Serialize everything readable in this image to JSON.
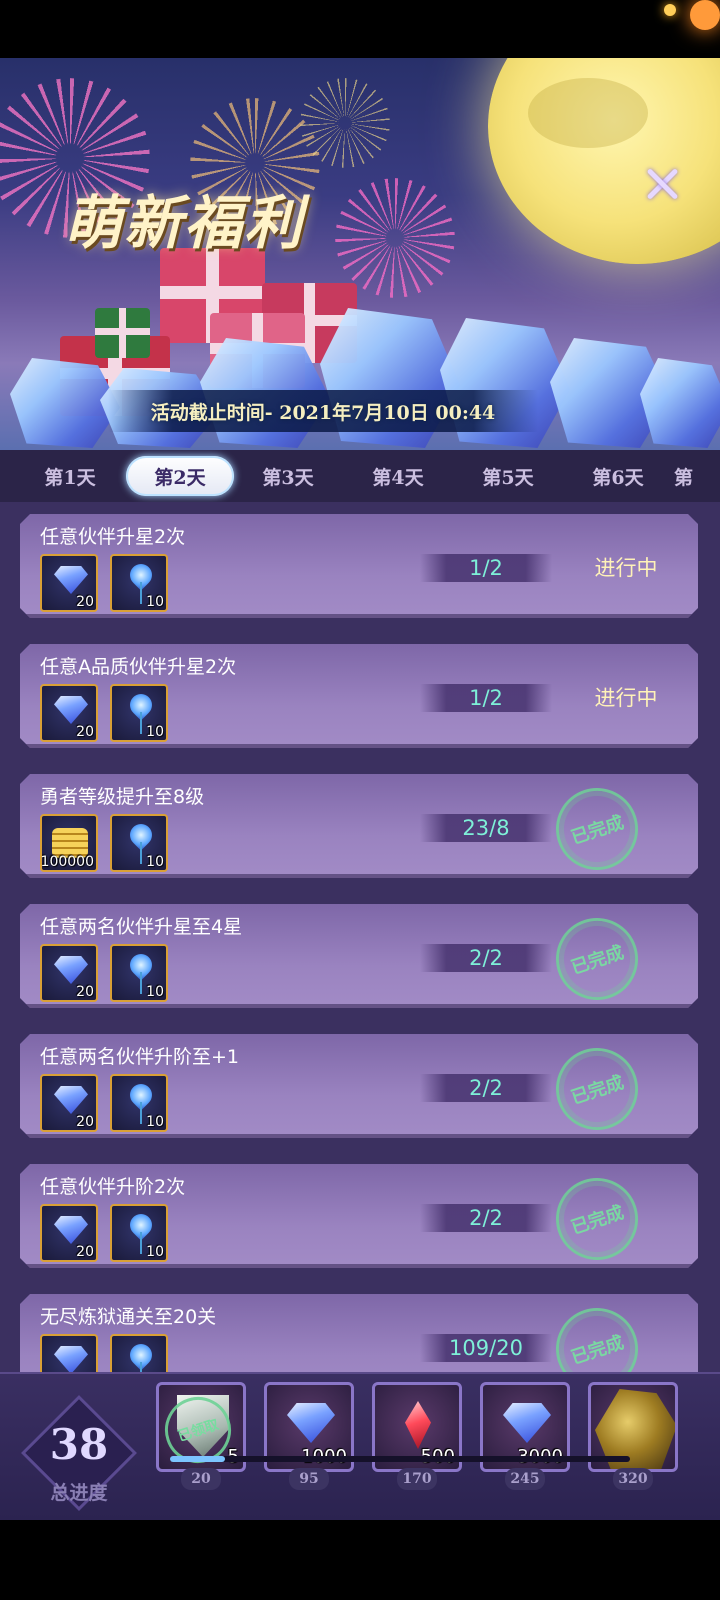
{
  "banner": {
    "title": "萌新福利",
    "deadline": "活动截止时间- 2021年7月10日 00:44"
  },
  "tabs": [
    {
      "label": "第1天",
      "active": false
    },
    {
      "label": "第2天",
      "active": true
    },
    {
      "label": "第3天",
      "active": false
    },
    {
      "label": "第4天",
      "active": false
    },
    {
      "label": "第5天",
      "active": false
    },
    {
      "label": "第6天",
      "active": false
    },
    {
      "label": "第",
      "active": false
    }
  ],
  "tasks": [
    {
      "title": "任意伙伴升星2次",
      "rewards": [
        {
          "icon": "diamond-icon",
          "qty": "20"
        },
        {
          "icon": "blue-flower-icon",
          "qty": "10"
        }
      ],
      "progress": "1/2",
      "status": "进行中",
      "completed": false
    },
    {
      "title": "任意A品质伙伴升星2次",
      "rewards": [
        {
          "icon": "diamond-icon",
          "qty": "20"
        },
        {
          "icon": "blue-flower-icon",
          "qty": "10"
        }
      ],
      "progress": "1/2",
      "status": "进行中",
      "completed": false
    },
    {
      "title": "勇者等级提升至8级",
      "rewards": [
        {
          "icon": "gold-coins-icon",
          "qty": "100000"
        },
        {
          "icon": "blue-flower-icon",
          "qty": "10"
        }
      ],
      "progress": "23/8",
      "status": "已完成",
      "completed": true
    },
    {
      "title": "任意两名伙伴升星至4星",
      "rewards": [
        {
          "icon": "diamond-icon",
          "qty": "20"
        },
        {
          "icon": "blue-flower-icon",
          "qty": "10"
        }
      ],
      "progress": "2/2",
      "status": "已完成",
      "completed": true
    },
    {
      "title": "任意两名伙伴升阶至+1",
      "rewards": [
        {
          "icon": "diamond-icon",
          "qty": "20"
        },
        {
          "icon": "blue-flower-icon",
          "qty": "10"
        }
      ],
      "progress": "2/2",
      "status": "已完成",
      "completed": true
    },
    {
      "title": "任意伙伴升阶2次",
      "rewards": [
        {
          "icon": "diamond-icon",
          "qty": "20"
        },
        {
          "icon": "blue-flower-icon",
          "qty": "10"
        }
      ],
      "progress": "2/2",
      "status": "已完成",
      "completed": true
    },
    {
      "title": "无尽炼狱通关至20关",
      "rewards": [
        {
          "icon": "diamond-icon",
          "qty": ""
        },
        {
          "icon": "blue-flower-icon",
          "qty": ""
        }
      ],
      "progress": "109/20",
      "status": "已完成",
      "completed": true
    }
  ],
  "footer": {
    "total_progress": "38",
    "total_label": "总进度",
    "progress_fraction": 0.12,
    "milestones": [
      {
        "icon": "shield-icon",
        "qty": "5",
        "claimed": true,
        "claimed_label": "已领取",
        "threshold": "20"
      },
      {
        "icon": "diamond-icon",
        "qty": "1000",
        "claimed": false,
        "threshold": "95"
      },
      {
        "icon": "red-crystal-icon",
        "qty": "500",
        "claimed": false,
        "threshold": "170"
      },
      {
        "icon": "diamond-icon",
        "qty": "3000",
        "claimed": false,
        "threshold": "245"
      },
      {
        "icon": "golden-knight-icon",
        "qty": "",
        "claimed": false,
        "threshold": "320"
      }
    ]
  },
  "colors": {
    "progress_text": "#7ef0d8",
    "status_in_progress": "#fff2b8",
    "stamp_green": "#78dca0",
    "card_purple": "#9a83c0"
  }
}
